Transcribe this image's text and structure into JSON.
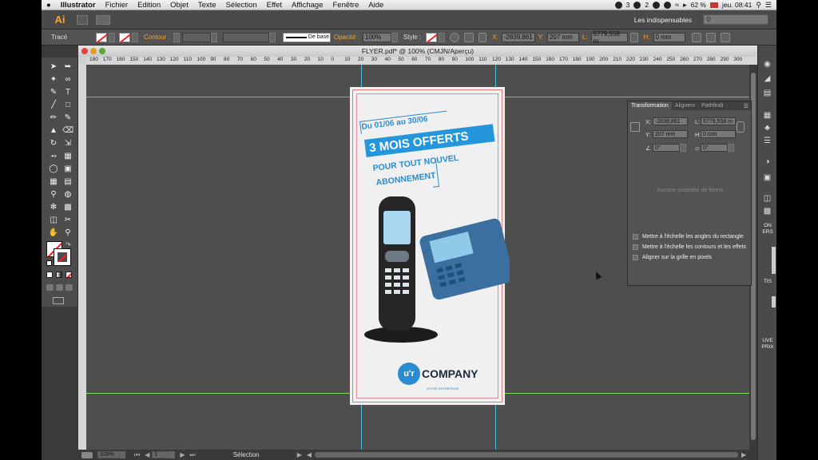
{
  "menubar": {
    "apple": "",
    "app_name": "Illustrator",
    "items": [
      "Fichier",
      "Edition",
      "Objet",
      "Texte",
      "Sélection",
      "Effet",
      "Affichage",
      "Fenêtre",
      "Aide"
    ],
    "tray_count_1": "3",
    "tray_count_2": "2",
    "battery": "62 %",
    "clock": "jeu. 08:41"
  },
  "appbar": {
    "logo": "Ai",
    "workspace": "Les indispensables"
  },
  "controlbar": {
    "object_type": "Tracé",
    "contour_label": "Contour :",
    "stroke_style": "De base",
    "opacity_label": "Opacité :",
    "opacity_value": "100%",
    "style_label": "Style :",
    "x_label": "X:",
    "x_value": "-2839,861",
    "y_label": "Y:",
    "y_value": "207 mm",
    "w_label": "L:",
    "w_value": "5779,558 m",
    "h_label": "H:",
    "h_value": "0 mm"
  },
  "document": {
    "title": "FLYER.pdf* @ 100% (CMJN/Aperçu)",
    "ruler_ticks": [
      "180",
      "170",
      "160",
      "150",
      "140",
      "130",
      "120",
      "110",
      "100",
      "90",
      "80",
      "70",
      "60",
      "50",
      "40",
      "30",
      "20",
      "10",
      "0",
      "10",
      "20",
      "30",
      "40",
      "50",
      "60",
      "70",
      "80",
      "90",
      "100",
      "110",
      "120",
      "130",
      "140",
      "150",
      "160",
      "170",
      "180",
      "190",
      "200",
      "210",
      "220",
      "230",
      "240",
      "250",
      "260",
      "270",
      "280",
      "290",
      "300"
    ]
  },
  "flyer": {
    "date_line": "Du 01/06 au 30/06",
    "headline": "3 MOIS OFFERTS",
    "sub_line_1": "POUR TOUT NOUVEL",
    "sub_line_2": "ABONNEMENT",
    "logo_mark": "u'r",
    "logo_word": "COMPANY",
    "logo_tagline": "VOTRE ENTREPRISE"
  },
  "transform_panel": {
    "tabs": [
      "Transformation",
      "Alignem",
      "Pathfindi"
    ],
    "x_label": "X:",
    "x_value": "-2839,861",
    "y_label": "Y:",
    "y_value": "207 mm",
    "w_label": "L:",
    "w_value": "5779,558 m",
    "h_label": "H:",
    "h_value": "0 mm",
    "rotate_value": "0°",
    "shear_value": "0°",
    "empty_message": "Aucune propriété de forme",
    "options": [
      "Mettre à l'échelle les angles du rectangle",
      "Mettre à l'échelle les contours et les effets",
      "Aligner sur la grille en pixels"
    ]
  },
  "statusbar": {
    "zoom": "100%",
    "page": "1",
    "tool": "Sélection"
  },
  "rightdock": {
    "label_1": "ON\nERS",
    "label_2": "TIS",
    "label_3": "UVE\nPRIX"
  },
  "colors": {
    "accent_orange": "#f2a33a",
    "guide_cyan": "#44c6d8",
    "guide_green": "#7adc5a",
    "flyer_blue": "#2496dc"
  }
}
